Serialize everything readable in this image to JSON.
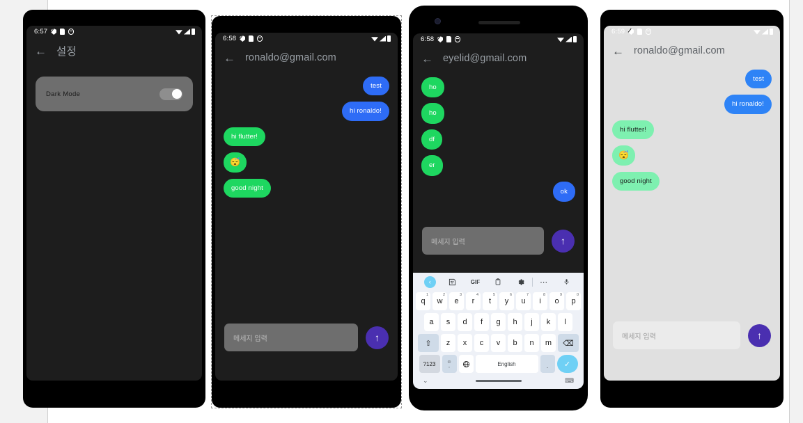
{
  "theme": {
    "page_bg": "#ffffff",
    "gutter_bg": "#f2f2f2",
    "dark_screen_bg": "#1d1d1d",
    "light_screen_bg": "#e0e0e0",
    "accent_send": "#4a2fb0",
    "bubble_me_dark": "#2e6cf6",
    "bubble_them_dark": "#1ed760",
    "bubble_me_light": "#2e83f6",
    "bubble_them_light": "#7ef0b0",
    "keyboard_bg": "#eef1f7",
    "keyboard_accent": "#6fd0f5"
  },
  "phone1": {
    "status": {
      "time": "6:57",
      "icons": [
        "shield-icon",
        "sim-icon",
        "circle-icon",
        "wifi-icon",
        "signal-icon",
        "battery-icon"
      ]
    },
    "appbar": {
      "back": "←",
      "title": "설정"
    },
    "setting": {
      "label": "Dark Mode",
      "toggle_state": "on"
    }
  },
  "phone2": {
    "status": {
      "time": "6:58"
    },
    "appbar": {
      "back": "←",
      "title": "ronaldo@gmail.com"
    },
    "messages": [
      {
        "text": "test",
        "side": "me",
        "kind": "text"
      },
      {
        "text": "hi ronaldo!",
        "side": "me",
        "kind": "text"
      },
      {
        "text": "hi flutter!",
        "side": "them",
        "kind": "text"
      },
      {
        "text": "😴",
        "side": "them",
        "kind": "emoji"
      },
      {
        "text": "good night",
        "side": "them",
        "kind": "text"
      }
    ],
    "composer": {
      "placeholder": "메세지 입력",
      "value": "",
      "send_icon": "↑"
    }
  },
  "phone3": {
    "status": {
      "time": "6:58"
    },
    "appbar": {
      "back": "←",
      "title": "eyelid@gmail.com"
    },
    "messages": [
      {
        "text": "ho",
        "side": "them",
        "kind": "tiny"
      },
      {
        "text": "ho",
        "side": "them",
        "kind": "tiny"
      },
      {
        "text": "df",
        "side": "them",
        "kind": "tiny"
      },
      {
        "text": "er",
        "side": "them",
        "kind": "tiny"
      },
      {
        "text": "ok",
        "side": "me",
        "kind": "tiny"
      }
    ],
    "composer": {
      "placeholder": "메세지 입력",
      "value": "",
      "send_icon": "↑"
    },
    "keyboard": {
      "toolbar": [
        {
          "name": "keyboard-back-icon",
          "glyph": "‹"
        },
        {
          "name": "sticker-icon",
          "glyph": "☺"
        },
        {
          "name": "gif-icon",
          "glyph": "GIF"
        },
        {
          "name": "clipboard-icon",
          "glyph": "Ὄb"
        },
        {
          "name": "gear-icon",
          "glyph": "⚙"
        },
        {
          "name": "toolbar-divider",
          "glyph": ""
        },
        {
          "name": "more-icon",
          "glyph": "⋯"
        },
        {
          "name": "microphone-icon",
          "glyph": "Ἲ4"
        }
      ],
      "row1": [
        {
          "key": "q",
          "sup": "1"
        },
        {
          "key": "w",
          "sup": "2"
        },
        {
          "key": "e",
          "sup": "3"
        },
        {
          "key": "r",
          "sup": "4"
        },
        {
          "key": "t",
          "sup": "5"
        },
        {
          "key": "y",
          "sup": "6"
        },
        {
          "key": "u",
          "sup": "7"
        },
        {
          "key": "i",
          "sup": "8"
        },
        {
          "key": "o",
          "sup": "9"
        },
        {
          "key": "p",
          "sup": "0"
        }
      ],
      "row2": [
        "a",
        "s",
        "d",
        "f",
        "g",
        "h",
        "j",
        "k",
        "l"
      ],
      "row3_shift": "⇧",
      "row3": [
        "z",
        "x",
        "c",
        "v",
        "b",
        "n",
        "m"
      ],
      "row3_backspace": "⌫",
      "row4": {
        "symbols": "?123",
        "emoji": "☺",
        "emoji_sub": ",",
        "globe": "ἱ0",
        "space_label": "English",
        "period": ".",
        "enter": "✓"
      },
      "bottom": {
        "hide": "⌄",
        "switcher": "⌨"
      }
    }
  },
  "phone4": {
    "status": {
      "time": "6:59"
    },
    "appbar": {
      "back": "←",
      "title": "ronaldo@gmail.com"
    },
    "messages": [
      {
        "text": "test",
        "side": "me",
        "kind": "text"
      },
      {
        "text": "hi ronaldo!",
        "side": "me",
        "kind": "text"
      },
      {
        "text": "hi flutter!",
        "side": "them",
        "kind": "text"
      },
      {
        "text": "😴",
        "side": "them",
        "kind": "emoji"
      },
      {
        "text": "good night",
        "side": "them",
        "kind": "text"
      }
    ],
    "composer": {
      "placeholder": "메세지 입력",
      "value": "",
      "send_icon": "↑"
    }
  }
}
